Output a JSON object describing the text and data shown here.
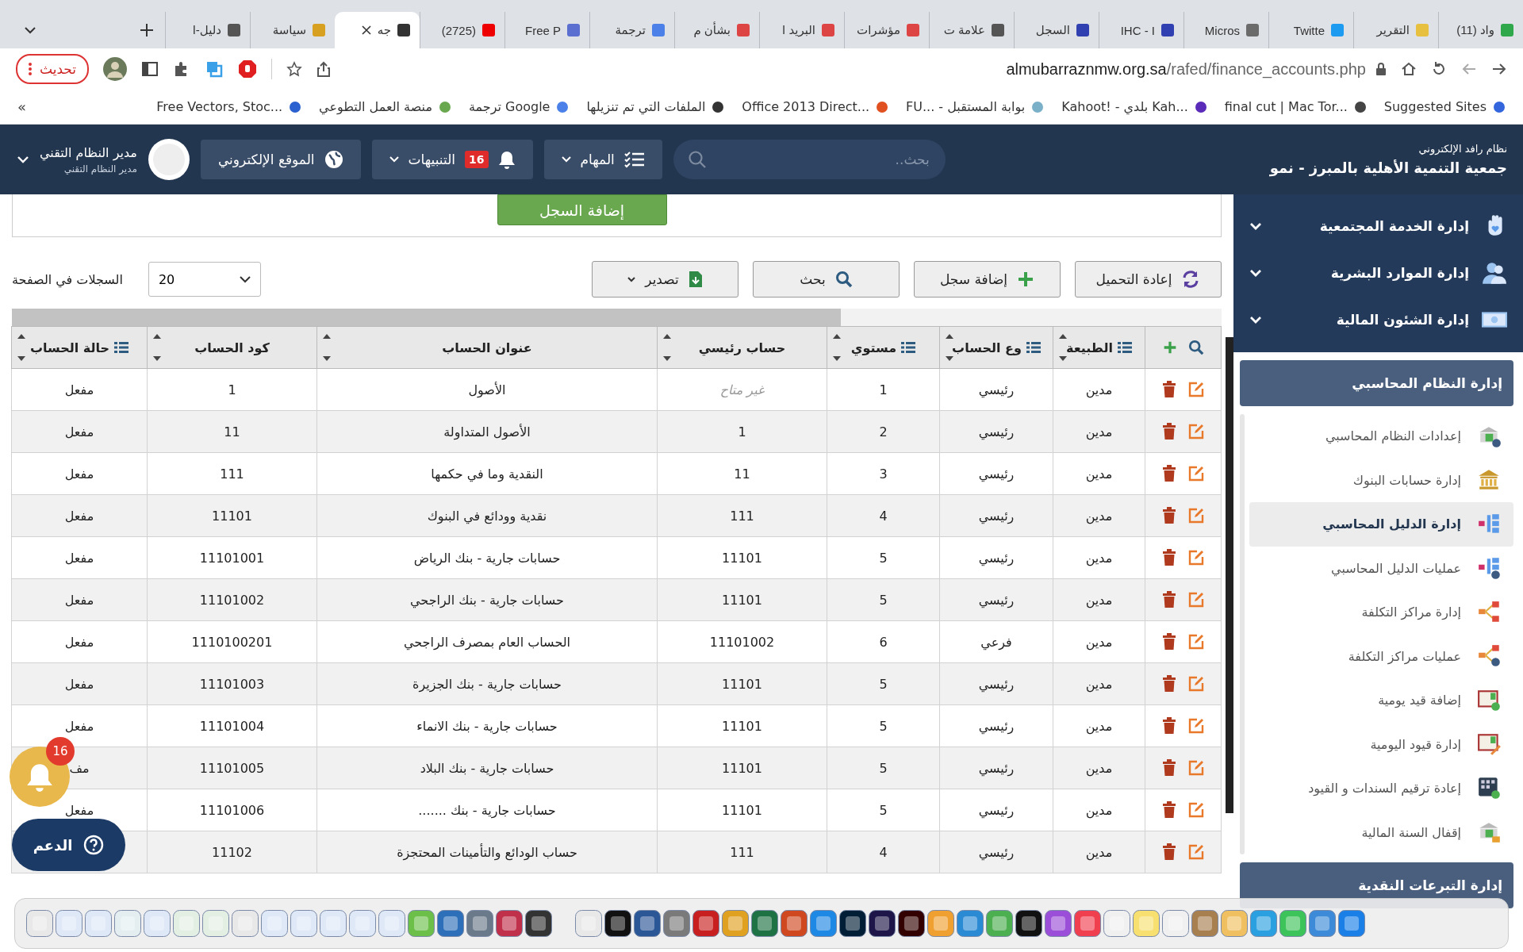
{
  "browser": {
    "tabs": [
      {
        "title": "(11) واد",
        "selected": false
      },
      {
        "title": "التقرير",
        "selected": false
      },
      {
        "title": "Twitte",
        "selected": false
      },
      {
        "title": "Micros",
        "selected": false
      },
      {
        "title": "IHC - I",
        "selected": false
      },
      {
        "title": "السجل",
        "selected": false
      },
      {
        "title": "علامة ت",
        "selected": false
      },
      {
        "title": "مؤشرات",
        "selected": false
      },
      {
        "title": "البريد ا",
        "selected": false
      },
      {
        "title": "بشأن م",
        "selected": false
      },
      {
        "title": "ترجمة",
        "selected": false
      },
      {
        "title": "Free P",
        "selected": false
      },
      {
        "title": "(2725)",
        "selected": false
      },
      {
        "title": "جه",
        "selected": true
      },
      {
        "title": "سياسة",
        "selected": false
      },
      {
        "title": "دليل-ا",
        "selected": false
      }
    ],
    "url_domain": "almubarraznmw.org.sa",
    "url_path": "/rafed/finance_accounts.php",
    "update_button": "تحديث",
    "bookmarks": [
      "Suggested Sites",
      "final cut | Mac Tor...",
      "Kahoot! - بلدي Kah...",
      "FU... - بوابة المستقبل",
      "Office 2013 Direct...",
      "الملفات التي تم تنزيلها",
      "ترجمة Google",
      "منصة العمل التطوعي",
      "Free Vectors, Stoc..."
    ],
    "bookmarks_overflow": "»"
  },
  "header": {
    "system_name": "نظام رافد الإلكتروني",
    "org_name": "جمعية التنمية الأهلية بالمبرز - نمو",
    "search_placeholder": "بحث..",
    "tasks": "المهام",
    "notifications": "التنبيهات",
    "notification_count": "16",
    "website": "الموقع الإلكتروني",
    "user_name": "مدير النظام التقني",
    "user_role": "مدير النظام التقني"
  },
  "sidebar": {
    "groups": [
      {
        "label": "إدارة الخدمة المجتمعية",
        "expanded": false
      },
      {
        "label": "إدارة الموارد البشرية",
        "expanded": false
      },
      {
        "label": "إدارة الشئون المالية",
        "expanded": false
      }
    ],
    "section": "إدارة النظام المحاسبي",
    "items": [
      {
        "label": "إعدادات النظام المحاسبي",
        "selected": false
      },
      {
        "label": "إدارة حسابات البنوك",
        "selected": false
      },
      {
        "label": "إدارة الدليل المحاسبي",
        "selected": true
      },
      {
        "label": "عمليات الدليل المحاسبي",
        "selected": false
      },
      {
        "label": "إدارة مراكز التكلفة",
        "selected": false
      },
      {
        "label": "عمليات مراكز التكلفة",
        "selected": false
      },
      {
        "label": "إضافة قيد يومية",
        "selected": false
      },
      {
        "label": "إدارة قيود اليومية",
        "selected": false
      },
      {
        "label": "إعادة ترقيم السندات و القيود",
        "selected": false
      },
      {
        "label": "إقفال السنة المالية",
        "selected": false
      }
    ],
    "next_section": "إدارة التبرعات النقدية"
  },
  "content": {
    "add_record_button": "إضافة السجل",
    "toolbar": [
      {
        "label": "إعادة التحميل",
        "kind": "reload"
      },
      {
        "label": "إضافة سجل",
        "kind": "add"
      },
      {
        "label": "بحث",
        "kind": "search"
      },
      {
        "label": "تصدير",
        "kind": "export"
      }
    ],
    "page_size": "20",
    "page_size_label": "السجلات في الصفحة",
    "table": {
      "columns": [
        {
          "label": "الطبيعة",
          "kind": "list"
        },
        {
          "label": "وع الحساب",
          "kind": "list"
        },
        {
          "label": "مستوي",
          "kind": "list"
        },
        {
          "label": "حساب رئيسي",
          "kind": "plain"
        },
        {
          "label": "عنوان الحساب",
          "kind": "plain"
        },
        {
          "label": "كود الحساب",
          "kind": "plain"
        },
        {
          "label": "حالة الحساب",
          "kind": "list"
        }
      ],
      "rows": [
        {
          "nature": "مدين",
          "type": "رئيسي",
          "level": "1",
          "parent": "غير متاح",
          "parent_muted": true,
          "title": "الأصول",
          "code": "1",
          "status": "مفعل"
        },
        {
          "nature": "مدين",
          "type": "رئيسي",
          "level": "2",
          "parent": "1",
          "parent_muted": false,
          "title": "الأصول المتداولة",
          "code": "11",
          "status": "مفعل"
        },
        {
          "nature": "مدين",
          "type": "رئيسي",
          "level": "3",
          "parent": "11",
          "parent_muted": false,
          "title": "النقدية وما في حكمها",
          "code": "111",
          "status": "مفعل"
        },
        {
          "nature": "مدين",
          "type": "رئيسي",
          "level": "4",
          "parent": "111",
          "parent_muted": false,
          "title": "نقدية وودائع في البنوك",
          "code": "11101",
          "status": "مفعل"
        },
        {
          "nature": "مدين",
          "type": "رئيسي",
          "level": "5",
          "parent": "11101",
          "parent_muted": false,
          "title": "حسابات جارية - بنك الرياض",
          "code": "11101001",
          "status": "مفعل"
        },
        {
          "nature": "مدين",
          "type": "رئيسي",
          "level": "5",
          "parent": "11101",
          "parent_muted": false,
          "title": "حسابات جارية - بنك الراجحي",
          "code": "11101002",
          "status": "مفعل"
        },
        {
          "nature": "مدين",
          "type": "فرعي",
          "level": "6",
          "parent": "11101002",
          "parent_muted": false,
          "title": "الحساب العام بمصرف الراجحي",
          "code": "1110100201",
          "status": "مفعل"
        },
        {
          "nature": "مدين",
          "type": "رئيسي",
          "level": "5",
          "parent": "11101",
          "parent_muted": false,
          "title": "حسابات جارية - بنك الجزيرة",
          "code": "11101003",
          "status": "مفعل"
        },
        {
          "nature": "مدين",
          "type": "رئيسي",
          "level": "5",
          "parent": "11101",
          "parent_muted": false,
          "title": "حسابات جارية - بنك الانماء",
          "code": "11101004",
          "status": "مفعل"
        },
        {
          "nature": "مدين",
          "type": "رئيسي",
          "level": "5",
          "parent": "11101",
          "parent_muted": false,
          "title": "حسابات جارية - بنك البلاد",
          "code": "11101005",
          "status": "مف"
        },
        {
          "nature": "مدين",
          "type": "رئيسي",
          "level": "5",
          "parent": "11101",
          "parent_muted": false,
          "title": "حسابات جارية - بنك .......",
          "code": "11101006",
          "status": "مفعل"
        },
        {
          "nature": "مدين",
          "type": "رئيسي",
          "level": "4",
          "parent": "111",
          "parent_muted": false,
          "title": "حساب الودائع والتأمينات المحتجزة",
          "code": "11102"
        }
      ]
    },
    "floating_notification_count": "16",
    "support_button": "الدعم"
  }
}
